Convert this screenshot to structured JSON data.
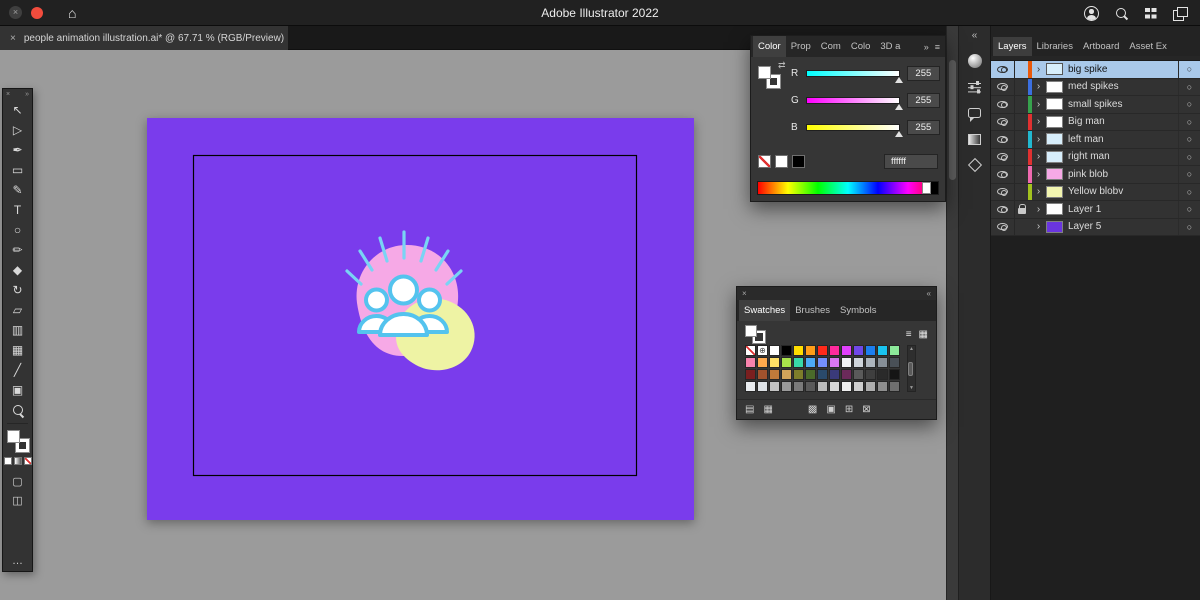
{
  "window": {
    "title": "Adobe Illustrator 2022"
  },
  "document_tab": {
    "title": "people animation illustration.ai* @ 67.71 % (RGB/Preview)"
  },
  "glyphs": {
    "close_x": "×",
    "home": "⌂",
    "collapse_left": "«",
    "collapse_right": "»",
    "panel_menu": "≡",
    "chevron": "›",
    "target": "○",
    "more": "…",
    "scroll_up": "▲",
    "scroll_down": "▼",
    "swap_arrows": "⇄",
    "registration": "⊕",
    "list_view": "≡",
    "grid_view": "▦"
  },
  "toolbar": {
    "tools": [
      {
        "name": "selection-tool",
        "glyph": "↖"
      },
      {
        "name": "direct-selection-tool",
        "glyph": "▷"
      },
      {
        "name": "pen-tool",
        "glyph": "✒"
      },
      {
        "name": "rectangle-tool",
        "glyph": "▭"
      },
      {
        "name": "paintbrush-tool",
        "glyph": "✎"
      },
      {
        "name": "type-tool",
        "glyph": "T"
      },
      {
        "name": "ellipse-tool",
        "glyph": "○"
      },
      {
        "name": "pencil-tool",
        "glyph": "✏"
      },
      {
        "name": "eraser-tool",
        "glyph": "◆"
      },
      {
        "name": "rotate-tool",
        "glyph": "↻"
      },
      {
        "name": "scale-tool",
        "glyph": "▱"
      },
      {
        "name": "gradient-tool",
        "glyph": "▥"
      },
      {
        "name": "mesh-tool",
        "glyph": "▦"
      },
      {
        "name": "eyedropper-tool",
        "glyph": "╱"
      },
      {
        "name": "artboard-tool",
        "glyph": "▣"
      },
      {
        "name": "zoom-tool",
        "glyph": "MAG"
      }
    ],
    "modes": [
      {
        "name": "draw-normal-icon",
        "glyph": "▢"
      },
      {
        "name": "screen-mode-icon",
        "glyph": "◫"
      }
    ]
  },
  "color_panel": {
    "tabs": [
      "Color",
      "Prop",
      "Com",
      "Colo",
      "3D a"
    ],
    "active_tab": "Color",
    "channels": [
      {
        "label": "R",
        "value": "255",
        "track_from": "#00ffff"
      },
      {
        "label": "G",
        "value": "255",
        "track_from": "#ff00ff"
      },
      {
        "label": "B",
        "value": "255",
        "track_from": "#ffff00"
      }
    ],
    "hex": "ffffff"
  },
  "swatches_panel": {
    "tabs": [
      "Swatches",
      "Brushes",
      "Symbols"
    ],
    "active_tab": "Swatches",
    "grid": [
      [
        "none",
        "reg",
        "#ffffff",
        "#000000",
        "#ffde00",
        "#ff9e18",
        "#ff2a1a",
        "#ff2a9d",
        "#e040fb",
        "#7048e8",
        "#1c7ef0",
        "#19c3f0",
        "#8ce99a"
      ],
      [
        "#f783ac",
        "#ffa94d",
        "#ffe066",
        "#a9e34b",
        "#38d9a9",
        "#4dabf7",
        "#748ffc",
        "#da77f2",
        "#f1f3f5",
        "#ced4da",
        "#adb5bd",
        "#868e96",
        "#495057"
      ],
      [
        "#7a1f1f",
        "#a0522d",
        "#c07a3a",
        "#d2a45a",
        "#7d7d2a",
        "#4a6b2a",
        "#2a4a6b",
        "#3a3a7a",
        "#6b2a5a",
        "#5a5a5a",
        "#3f3f3f",
        "#2a2a2a",
        "#151515"
      ],
      [
        "#e9ecef",
        "#dee2e6",
        "#c2c2c2",
        "#9a9a9a",
        "#7a7a7a",
        "#5a5a5a",
        "#bcbcbc",
        "#d8d8d8",
        "#efefef",
        "#cfcfcf",
        "#afafaf",
        "#8f8f8f",
        "#6f6f6f"
      ]
    ],
    "footer_icons": [
      {
        "name": "swatch-libraries-icon",
        "glyph": "▤"
      },
      {
        "name": "swatch-kinds-icon",
        "glyph": "▦"
      },
      {
        "name": "swatch-options-icon",
        "glyph": "▩"
      },
      {
        "name": "new-color-group-icon",
        "glyph": "▣"
      },
      {
        "name": "new-swatch-icon",
        "glyph": "⊞"
      },
      {
        "name": "delete-swatch-icon",
        "glyph": "⊠"
      }
    ]
  },
  "dock": {
    "icons": [
      {
        "name": "color-panel-icon",
        "shape": "sphere"
      },
      {
        "name": "properties-panel-icon",
        "shape": "sliders"
      },
      {
        "name": "comments-panel-icon",
        "shape": "bubble"
      },
      {
        "name": "gradient-panel-icon",
        "shape": "gradient"
      },
      {
        "name": "3d-materials-panel-icon",
        "shape": "cube"
      }
    ]
  },
  "layers_panel": {
    "tabs": [
      "Layers",
      "Libraries",
      "Artboard",
      "Asset Ex"
    ],
    "active_tab": "Layers",
    "selection_color": "#a9c9ea",
    "layers": [
      {
        "name": "big spike",
        "color": "#e8590c",
        "thumb": "#d7eefb",
        "selected": true,
        "visible": true,
        "locked": false
      },
      {
        "name": "med spikes",
        "color": "#3b6fe0",
        "thumb": "#ffffff",
        "selected": false,
        "visible": true,
        "locked": false
      },
      {
        "name": "small spikes",
        "color": "#37a24d",
        "thumb": "#ffffff",
        "selected": false,
        "visible": true,
        "locked": false
      },
      {
        "name": "Big man",
        "color": "#e03131",
        "thumb": "#ffffff",
        "selected": false,
        "visible": true,
        "locked": false
      },
      {
        "name": "left man",
        "color": "#22b8cf",
        "thumb": "#d7eefb",
        "selected": false,
        "visible": true,
        "locked": false
      },
      {
        "name": "right man",
        "color": "#e03131",
        "thumb": "#d7eefb",
        "selected": false,
        "visible": true,
        "locked": false
      },
      {
        "name": "pink blob",
        "color": "#f06ab0",
        "thumb": "#f6a9e6",
        "selected": false,
        "visible": true,
        "locked": false
      },
      {
        "name": "Yellow blobv",
        "color": "#a3c21f",
        "thumb": "#f2f5b0",
        "selected": false,
        "visible": true,
        "locked": false
      },
      {
        "name": "Layer 1",
        "color": null,
        "thumb": "#ffffff",
        "selected": false,
        "visible": true,
        "locked": true
      },
      {
        "name": "Layer 5",
        "color": null,
        "thumb": "#6a35e0",
        "selected": false,
        "visible": true,
        "locked": false
      }
    ]
  },
  "canvas": {
    "pasteboard_color": "#9b9b9b",
    "artboard_color": "#7a3cec",
    "frame_stroke": "#000000",
    "illustration": {
      "pink_blob": "#f6a9e6",
      "yellow_blob": "#eef3a4",
      "figure_fill": "#ffffff",
      "figure_stroke": "#54c3ee",
      "spike_color": "#79d4f4"
    }
  }
}
